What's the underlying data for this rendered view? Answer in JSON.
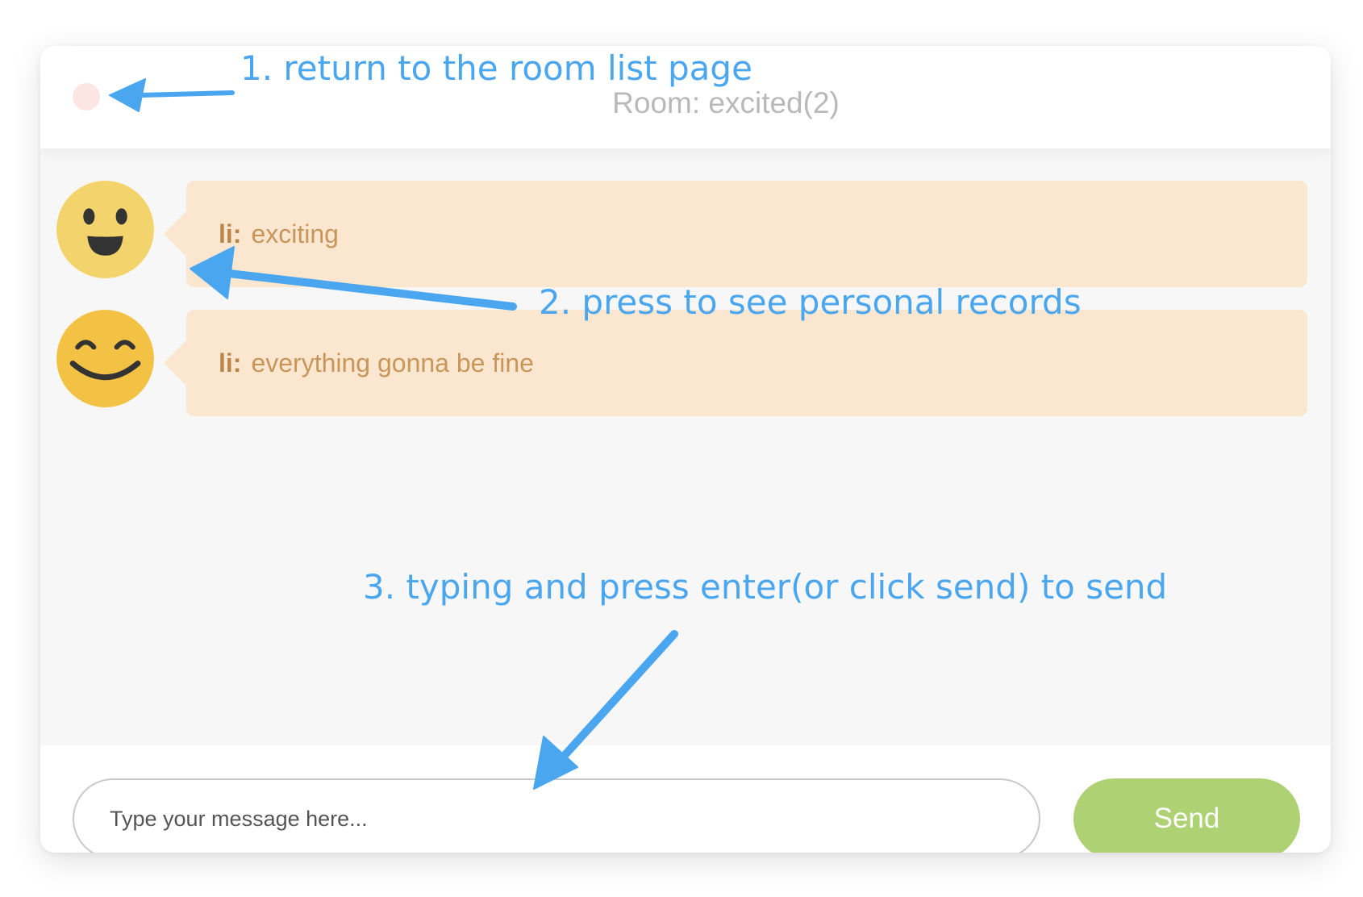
{
  "header": {
    "back_icon": "back-dot-icon",
    "room_title": "Room: excited(2)"
  },
  "messages": [
    {
      "sender": "li:",
      "text": "exciting",
      "avatar_icon": "grinning-face-icon"
    },
    {
      "sender": "li:",
      "text": "everything gonna be fine",
      "avatar_icon": "smiling-face-icon"
    }
  ],
  "composer": {
    "placeholder": "Type your message here...",
    "send_label": "Send"
  },
  "annotations": {
    "step1": "1. return to the room list page",
    "step2": "2. press to see personal records",
    "step3": "3. typing and press enter(or click send) to send"
  },
  "colors": {
    "annotation": "#4aa6ef",
    "bubble": "#fbe7d0",
    "send": "#aed273",
    "back_button": "#fbe6e3"
  }
}
